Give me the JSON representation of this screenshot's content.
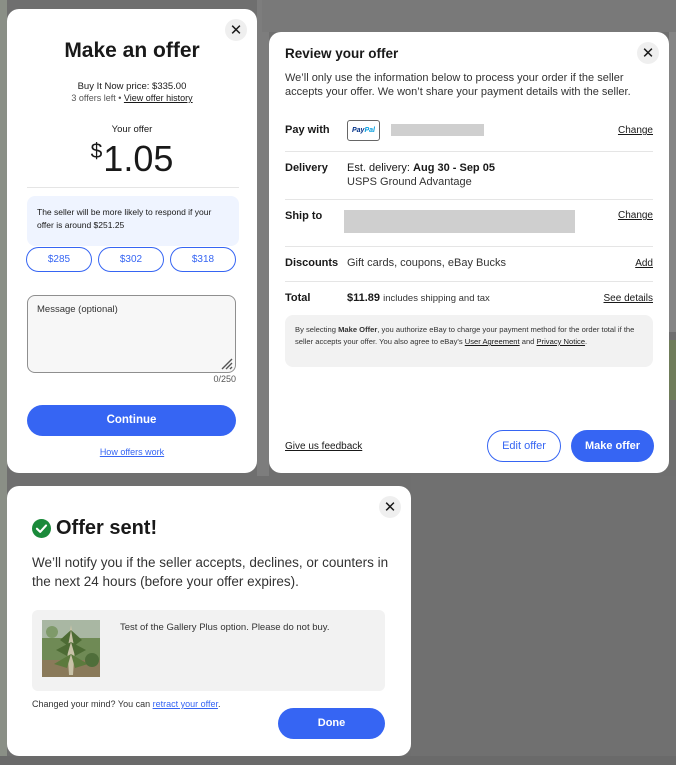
{
  "offer": {
    "title": "Make an offer",
    "bin_price": "Buy It Now price: $335.00",
    "offers_left": "3 offers left •",
    "history_link": "View offer history",
    "your_offer_label": "Your offer",
    "currency": "$",
    "amount": "1.05",
    "hint": "The seller will be more likely to respond if your offer is around $251.25",
    "suggestions": [
      "$285",
      "$302",
      "$318"
    ],
    "message_placeholder": "Message (optional)",
    "char_count": "0/250",
    "continue_label": "Continue",
    "how_link": "How offers work",
    "close": "✕"
  },
  "review": {
    "title": "Review your offer",
    "intro": "We’ll only use the information below to process your order if the seller accepts your offer. We won’t share your payment details with the seller.",
    "pay_with": {
      "label": "Pay with",
      "paypal_a": "Pay",
      "paypal_b": "Pal",
      "action": "Change"
    },
    "delivery": {
      "label": "Delivery",
      "est_prefix": "Est. delivery:",
      "dates": "Aug 30 - Sep 05",
      "method": "USPS Ground Advantage"
    },
    "ship_to": {
      "label": "Ship to",
      "action": "Change"
    },
    "discounts": {
      "label": "Discounts",
      "value": "Gift cards, coupons, eBay Bucks",
      "action": "Add"
    },
    "total": {
      "label": "Total",
      "amount": "$11.89",
      "note": "includes shipping and tax",
      "action": "See details"
    },
    "legal": {
      "p1": "By selecting ",
      "bold": "Make Offer",
      "p2": ", you authorize eBay to charge your payment method for the order total if the seller accepts your offer. You also agree to eBay's ",
      "link1": "User Agreement",
      "p3": " and ",
      "link2": "Privacy Notice",
      "p4": "."
    },
    "feedback": "Give us feedback",
    "edit_label": "Edit offer",
    "make_label": "Make offer",
    "close": "✕"
  },
  "sent": {
    "title": "Offer sent!",
    "desc": "We’ll notify you if the seller accepts, declines, or counters in the next 24 hours (before your offer expires).",
    "item_title": "Test of the Gallery Plus option. Please do not buy.",
    "changed_prefix": "Changed your mind? You can ",
    "retract_link": "retract your offer",
    "changed_suffix": ".",
    "done_label": "Done",
    "close": "✕"
  },
  "colors": {
    "accent": "#3665f3",
    "success": "#1a8a3a",
    "hint_bg": "#eff4ff"
  }
}
